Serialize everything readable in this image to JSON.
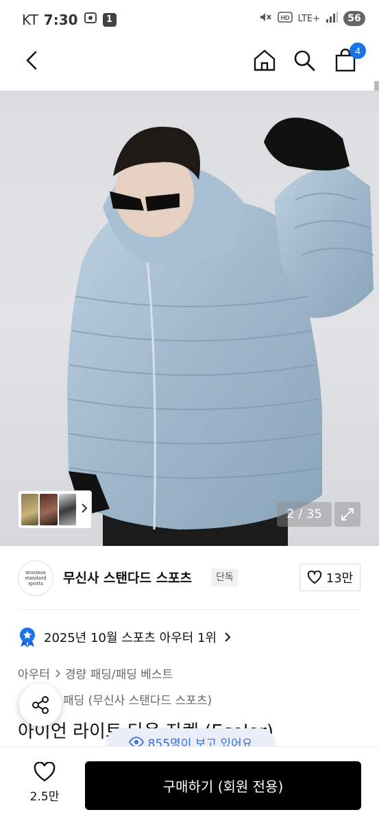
{
  "status_bar": {
    "carrier": "KT",
    "time": "7:30",
    "notification_count": "1",
    "network": "LTE+",
    "battery": "56"
  },
  "nav": {
    "cart_count": "4"
  },
  "gallery": {
    "counter": "2 / 35"
  },
  "brand": {
    "logo_lines": [
      "musinsa",
      "standard",
      "sports"
    ],
    "name": "무신사 스탠다드 스포츠",
    "tag": "단독",
    "likes": "13만"
  },
  "ranking": {
    "text": "2025년 10월 스포츠 아우터 1위"
  },
  "breadcrumb": {
    "level1": "아우터",
    "level2": "경량 패딩/패딩 베스트",
    "sub": "패딩 (무신사 스탠다드 스포츠)"
  },
  "product": {
    "title": "아이언 라이트 다운 자켓 (Ecolor)"
  },
  "viewers": {
    "text": "855명이 보고 있어요"
  },
  "bottom_bar": {
    "wish_count": "2.5만",
    "buy_label": "구매하기 (회원 전용)"
  },
  "colors": {
    "accent": "#1a73e8",
    "buy_button": "#000000",
    "jacket": "#a9c0d4"
  }
}
